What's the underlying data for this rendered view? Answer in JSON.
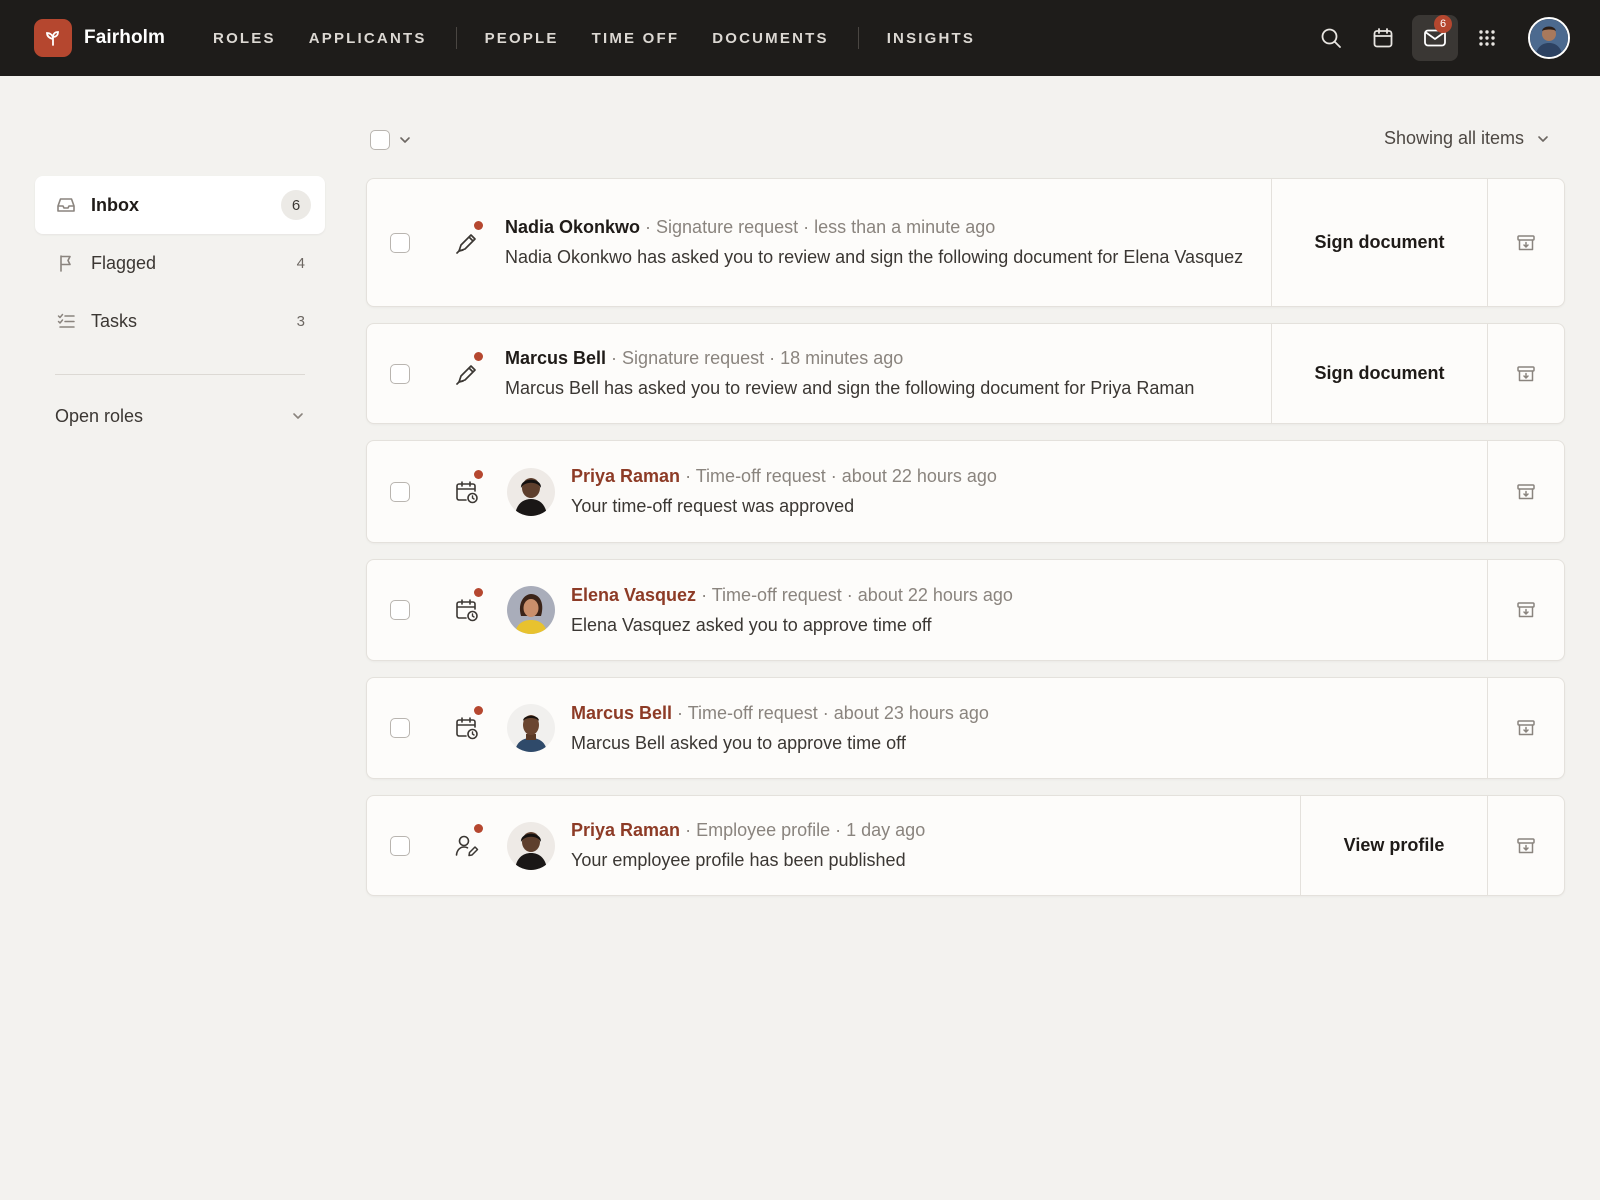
{
  "brand": {
    "name": "Fairholm",
    "logo_icon": "sprout-icon",
    "accent": "#b5472f"
  },
  "nav": {
    "group1": [
      "ROLES",
      "APPLICANTS"
    ],
    "group2": [
      "PEOPLE",
      "TIME OFF",
      "DOCUMENTS"
    ],
    "group3": [
      "INSIGHTS"
    ]
  },
  "toolbar": {
    "tools": [
      "search-icon",
      "calendar-icon",
      "mail-icon",
      "apps-grid-icon"
    ],
    "mail_badge": "6"
  },
  "sidebar": {
    "items": [
      {
        "label": "Inbox",
        "count": "6",
        "icon": "inbox-icon"
      },
      {
        "label": "Flagged",
        "count": "4",
        "icon": "flag-icon"
      },
      {
        "label": "Tasks",
        "count": "3",
        "icon": "tasks-icon"
      }
    ],
    "section": "Open roles"
  },
  "list_header": {
    "filter_label": "Showing all items"
  },
  "notifications": [
    {
      "name": "Nadia Okonkwo",
      "type": "Signature request",
      "time": "less than a minute ago",
      "message": "Nadia Okonkwo has asked you to review and sign the following document for Elena Vasquez",
      "icon": "pen-icon",
      "action": "Sign document"
    },
    {
      "name": "Marcus Bell",
      "type": "Signature request",
      "time": "18 minutes ago",
      "message": "Marcus Bell has asked you to review and sign the following document for Priya Raman",
      "icon": "pen-icon",
      "action": "Sign document"
    },
    {
      "name": "Priya Raman",
      "type": "Time-off request",
      "time": "about 22 hours ago",
      "message": "Your time-off request was approved",
      "icon": "calendar-clock-icon",
      "action": ""
    },
    {
      "name": "Elena Vasquez",
      "type": "Time-off request",
      "time": "about 22 hours ago",
      "message": "Elena Vasquez asked you to approve time off",
      "icon": "calendar-clock-icon",
      "action": ""
    },
    {
      "name": "Marcus Bell",
      "type": "Time-off request",
      "time": "about 23 hours ago",
      "message": "Marcus Bell asked you to approve time off",
      "icon": "calendar-clock-icon",
      "action": ""
    },
    {
      "name": "Priya Raman",
      "type": "Employee profile",
      "time": "1 day ago",
      "message": "Your employee profile has been published",
      "icon": "user-edit-icon",
      "action": "View profile"
    }
  ],
  "separator": " · "
}
